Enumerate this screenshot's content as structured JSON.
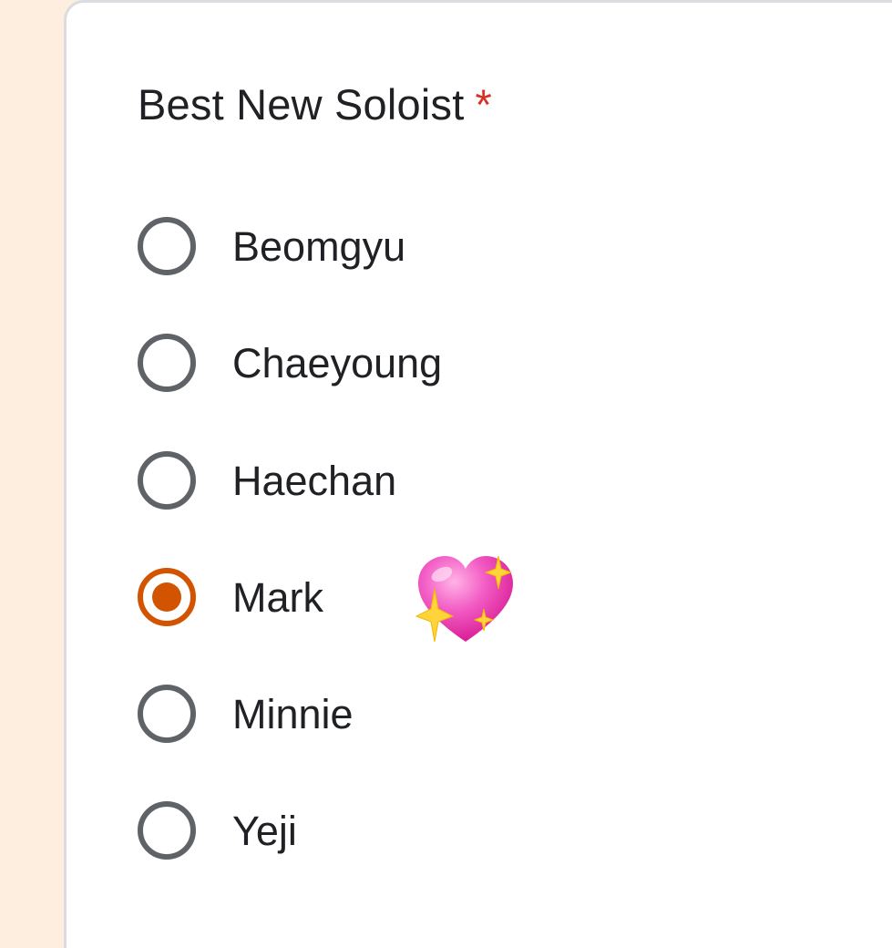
{
  "question": {
    "title": "Best New Soloist",
    "required_marker": "*"
  },
  "options": [
    {
      "label": "Beomgyu",
      "selected": false
    },
    {
      "label": "Chaeyoung",
      "selected": false
    },
    {
      "label": "Haechan",
      "selected": false
    },
    {
      "label": "Mark",
      "selected": true,
      "emoji": "sparkling-heart-icon"
    },
    {
      "label": "Minnie",
      "selected": false
    },
    {
      "label": "Yeji",
      "selected": false
    }
  ],
  "colors": {
    "page_background": "#fdeee0",
    "card_background": "#ffffff",
    "radio_unselected": "#5f6368",
    "radio_selected": "#d35400",
    "required_star": "#d93025",
    "text": "#202124"
  }
}
